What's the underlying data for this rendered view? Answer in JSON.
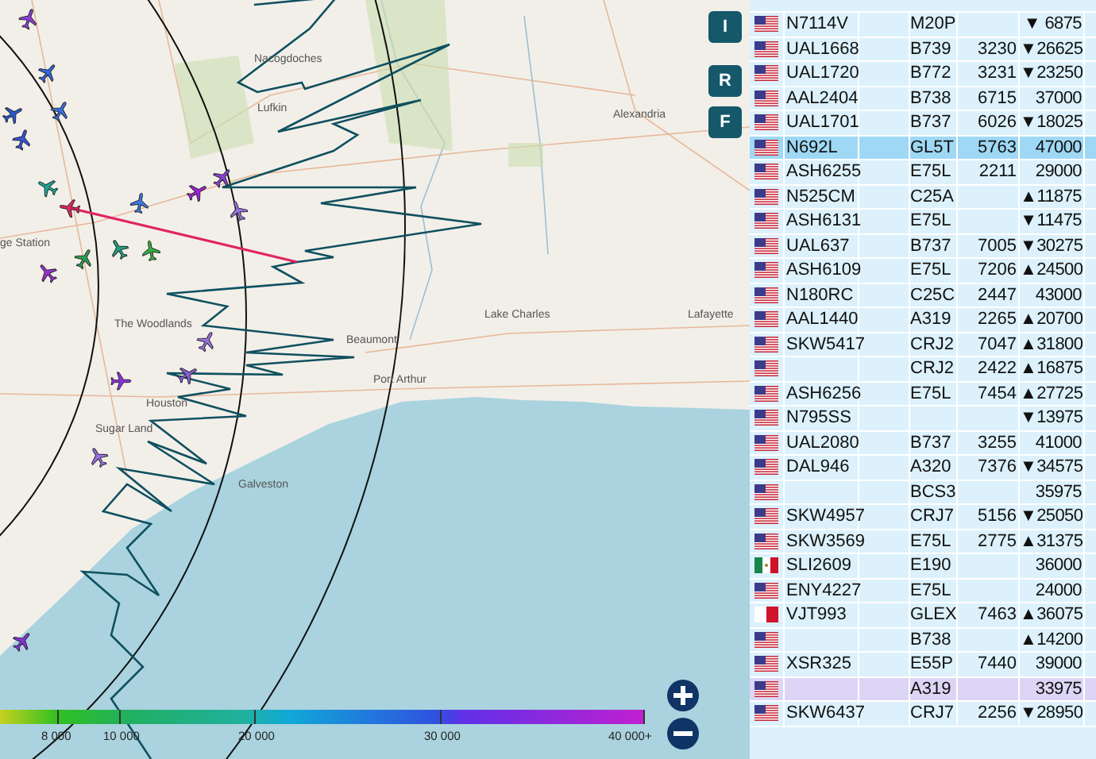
{
  "map": {
    "place_labels": [
      "Nacogdoches",
      "Lufkin",
      "Alexandria",
      "ge Station",
      "The Woodlands",
      "Lake Charles",
      "Lafayette",
      "Beaumont",
      "Port Arthur",
      "Houston",
      "Sugar Land",
      "Galveston"
    ]
  },
  "side_buttons": [
    {
      "label": "I"
    },
    {
      "label": "R"
    },
    {
      "label": "F"
    }
  ],
  "legend": {
    "labels": [
      "8 000",
      "10 000",
      "20 000",
      "30 000",
      "40 000+"
    ]
  },
  "aircraft": [
    {
      "kind": "us",
      "callsign": "N7114V",
      "type": "M20P",
      "altitude": "▼ 6875",
      "selected": false,
      "highlighted": false
    },
    {
      "kind": "us",
      "callsign": "UAL1668",
      "type": "B739",
      "squawk": "3230",
      "altitude": "▼26625",
      "selected": false,
      "highlighted": false
    },
    {
      "kind": "us",
      "callsign": "UAL1720",
      "type": "B772",
      "squawk": "3231",
      "altitude": "▼23250",
      "selected": false,
      "highlighted": false
    },
    {
      "kind": "us",
      "callsign": "AAL2404",
      "type": "B738",
      "squawk": "6715",
      "altitude": "37000",
      "selected": false,
      "highlighted": false
    },
    {
      "kind": "us",
      "callsign": "UAL1701",
      "type": "B737",
      "squawk": "6026",
      "altitude": "▼18025",
      "selected": false,
      "highlighted": false
    },
    {
      "kind": "us",
      "callsign": "N692L",
      "type": "GL5T",
      "squawk": "5763",
      "altitude": "47000",
      "selected": true,
      "highlighted": false
    },
    {
      "kind": "us",
      "callsign": "ASH6255",
      "type": "E75L",
      "squawk": "2211",
      "altitude": "29000",
      "selected": false,
      "highlighted": false
    },
    {
      "kind": "us",
      "callsign": "N525CM",
      "type": "C25A",
      "altitude": "▲11875",
      "selected": false,
      "highlighted": false
    },
    {
      "kind": "us",
      "callsign": "ASH6131",
      "type": "E75L",
      "altitude": "▼11475",
      "selected": false,
      "highlighted": false
    },
    {
      "kind": "us",
      "callsign": "UAL637",
      "type": "B737",
      "squawk": "7005",
      "altitude": "▼30275",
      "selected": false,
      "highlighted": false
    },
    {
      "kind": "us",
      "callsign": "ASH6109",
      "type": "E75L",
      "squawk": "7206",
      "altitude": "▲24500",
      "selected": false,
      "highlighted": false
    },
    {
      "kind": "us",
      "callsign": "N180RC",
      "type": "C25C",
      "squawk": "2447",
      "altitude": "43000",
      "selected": false,
      "highlighted": false
    },
    {
      "kind": "us",
      "callsign": "AAL1440",
      "type": "A319",
      "squawk": "2265",
      "altitude": "▲20700",
      "selected": false,
      "highlighted": false
    },
    {
      "kind": "us",
      "callsign": "SKW5417",
      "type": "CRJ2",
      "squawk": "7047",
      "altitude": "▲31800",
      "selected": false,
      "highlighted": false
    },
    {
      "kind": "us",
      "type": "CRJ2",
      "squawk": "2422",
      "altitude": "▲16875",
      "selected": false,
      "highlighted": false
    },
    {
      "kind": "us",
      "callsign": "ASH6256",
      "type": "E75L",
      "squawk": "7454",
      "altitude": "▲27725",
      "selected": false,
      "highlighted": false
    },
    {
      "kind": "us",
      "callsign": "N795SS",
      "altitude": "▼13975",
      "selected": false,
      "highlighted": false
    },
    {
      "kind": "us",
      "callsign": "UAL2080",
      "type": "B737",
      "squawk": "3255",
      "altitude": "41000",
      "selected": false,
      "highlighted": false
    },
    {
      "kind": "us",
      "callsign": "DAL946",
      "type": "A320",
      "squawk": "7376",
      "altitude": "▼34575",
      "selected": false,
      "highlighted": false
    },
    {
      "kind": "us",
      "type": "BCS3",
      "altitude": "35975",
      "selected": false,
      "highlighted": false
    },
    {
      "kind": "us",
      "callsign": "SKW4957",
      "type": "CRJ7",
      "squawk": "5156",
      "altitude": "▼25050",
      "selected": false,
      "highlighted": false
    },
    {
      "kind": "us",
      "callsign": "SKW3569",
      "type": "E75L",
      "squawk": "2775",
      "altitude": "▲31375",
      "selected": false,
      "highlighted": false
    },
    {
      "kind": "mx",
      "callsign": "SLI2609",
      "type": "E190",
      "altitude": "36000",
      "selected": false,
      "highlighted": false
    },
    {
      "kind": "us",
      "callsign": "ENY4227",
      "type": "E75L",
      "altitude": "24000",
      "selected": false,
      "highlighted": false
    },
    {
      "kind": "mt",
      "callsign": "VJT993",
      "type": "GLEX",
      "squawk": "7463",
      "altitude": "▲36075",
      "selected": false,
      "highlighted": false
    },
    {
      "kind": "us",
      "type": "B738",
      "altitude": "▲14200",
      "selected": false,
      "highlighted": false
    },
    {
      "kind": "us",
      "callsign": "XSR325",
      "type": "E55P",
      "squawk": "7440",
      "altitude": "39000",
      "selected": false,
      "highlighted": false
    },
    {
      "kind": "us",
      "type": "A319",
      "altitude": "33975",
      "selected": false,
      "highlighted": true
    },
    {
      "kind": "us",
      "callsign": "SKW6437",
      "type": "CRJ7",
      "squawk": "2256",
      "altitude": "▼28950",
      "selected": false,
      "highlighted": false
    }
  ]
}
